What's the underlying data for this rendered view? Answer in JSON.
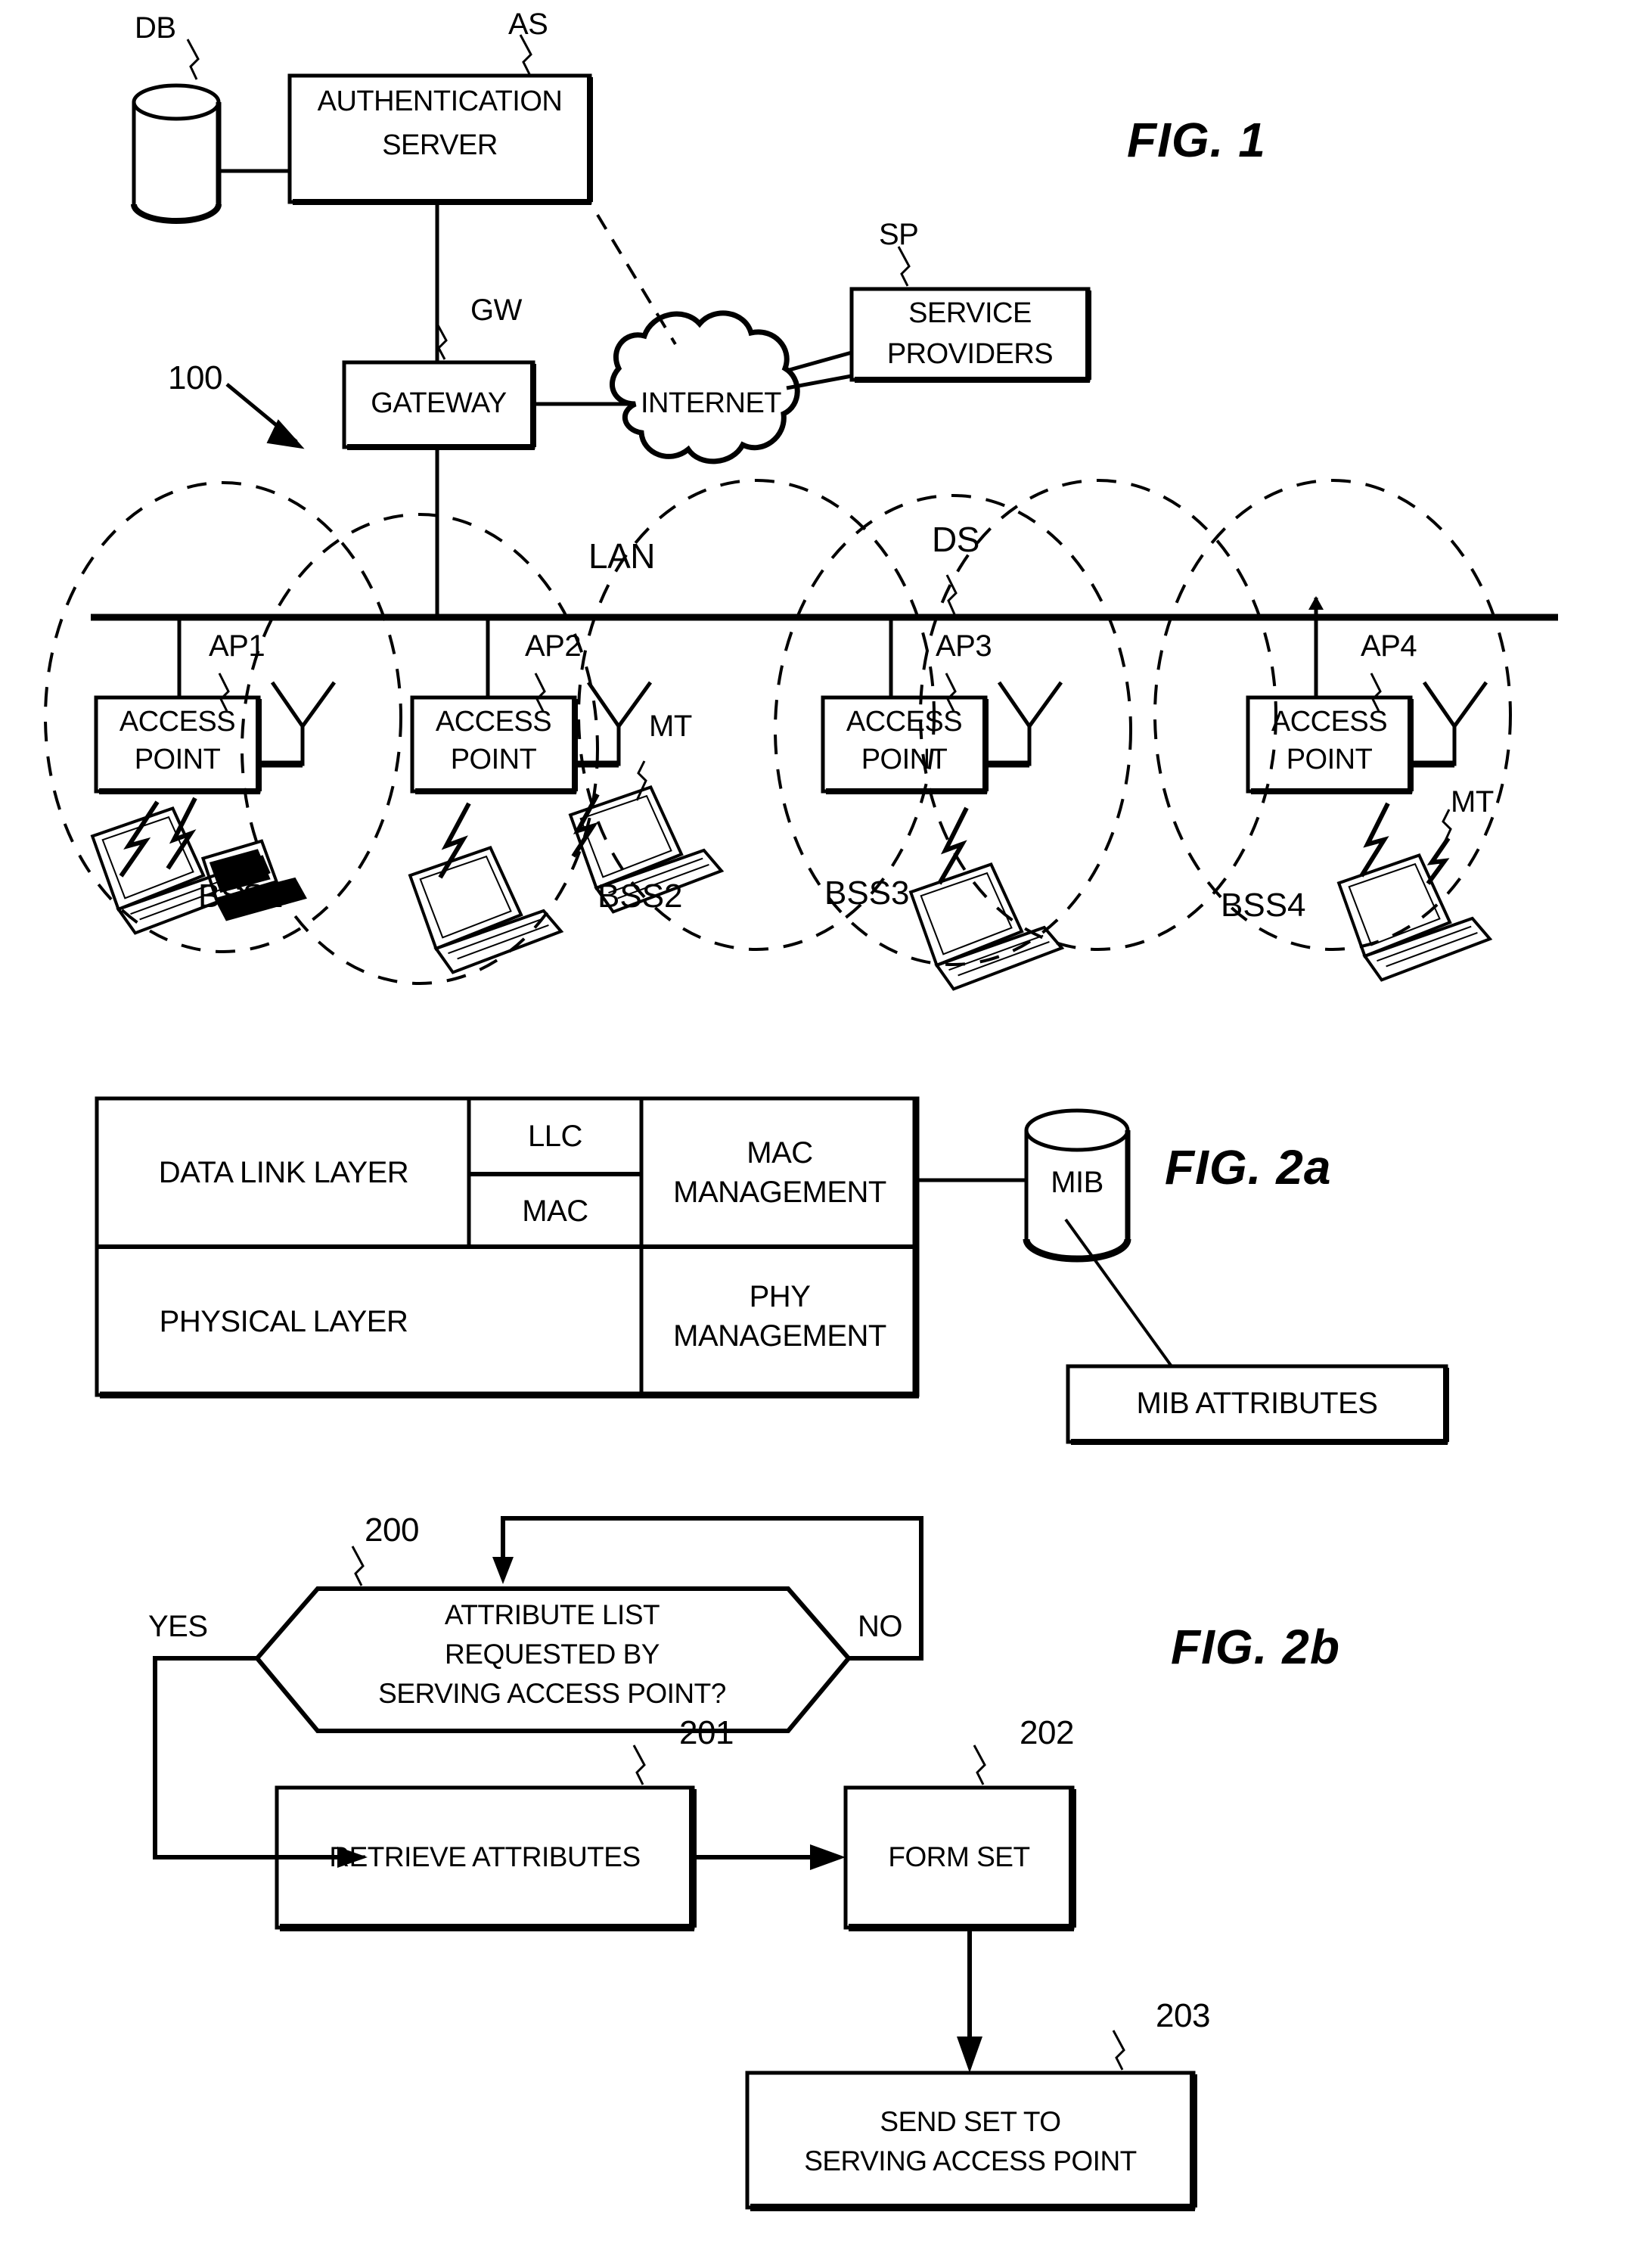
{
  "figures": [
    {
      "id": "fig1",
      "label": "FIG. 1"
    },
    {
      "id": "fig2a",
      "label": "FIG. 2a"
    },
    {
      "id": "fig2b",
      "label": "FIG. 2b"
    }
  ],
  "fig1": {
    "title": "FIG. 1",
    "system_ref": "100",
    "nodes": {
      "db": {
        "ref": "DB",
        "label": ""
      },
      "auth_server": {
        "ref": "AS",
        "line1": "AUTHENTICATION",
        "line2": "SERVER"
      },
      "gateway": {
        "ref": "GW",
        "label": "GATEWAY"
      },
      "internet": {
        "label": "INTERNET"
      },
      "service_providers": {
        "ref": "SP",
        "line1": "SERVICE",
        "line2": "PROVIDERS"
      },
      "lan": {
        "label": "LAN"
      },
      "ds": {
        "label": "DS"
      }
    },
    "access_points": [
      {
        "ref": "AP1",
        "line1": "ACCESS",
        "line2": "POINT",
        "bss": "BSS1",
        "mt": ""
      },
      {
        "ref": "AP2",
        "line1": "ACCESS",
        "line2": "POINT",
        "bss": "BSS2",
        "mt": "MT"
      },
      {
        "ref": "AP3",
        "line1": "ACCESS",
        "line2": "POINT",
        "bss": "BSS3",
        "mt": ""
      },
      {
        "ref": "AP4",
        "line1": "ACCESS",
        "line2": "POINT",
        "bss": "BSS4",
        "mt": "MT"
      }
    ]
  },
  "fig2a": {
    "title": "FIG. 2a",
    "table": {
      "rows": [
        {
          "layer": "DATA LINK LAYER",
          "sublayers": [
            "LLC",
            "MAC"
          ],
          "management_line1": "MAC",
          "management_line2": "MANAGEMENT"
        },
        {
          "layer": "PHYSICAL LAYER",
          "sublayers": [],
          "management_line1": "PHY",
          "management_line2": "MANAGEMENT"
        }
      ]
    },
    "mib": {
      "label": "MIB"
    },
    "mib_attributes": {
      "label": "MIB ATTRIBUTES"
    }
  },
  "fig2b": {
    "title": "FIG. 2b",
    "decision": {
      "ref": "200",
      "line1": "ATTRIBUTE LIST",
      "line2": "REQUESTED BY",
      "line3": "SERVING ACCESS POINT?",
      "yes_label": "YES",
      "no_label": "NO"
    },
    "steps": [
      {
        "ref": "201",
        "label": "RETRIEVE ATTRIBUTES"
      },
      {
        "ref": "202",
        "label": "FORM SET"
      },
      {
        "ref": "203",
        "line1": "SEND SET TO",
        "line2": "SERVING ACCESS POINT"
      }
    ]
  }
}
